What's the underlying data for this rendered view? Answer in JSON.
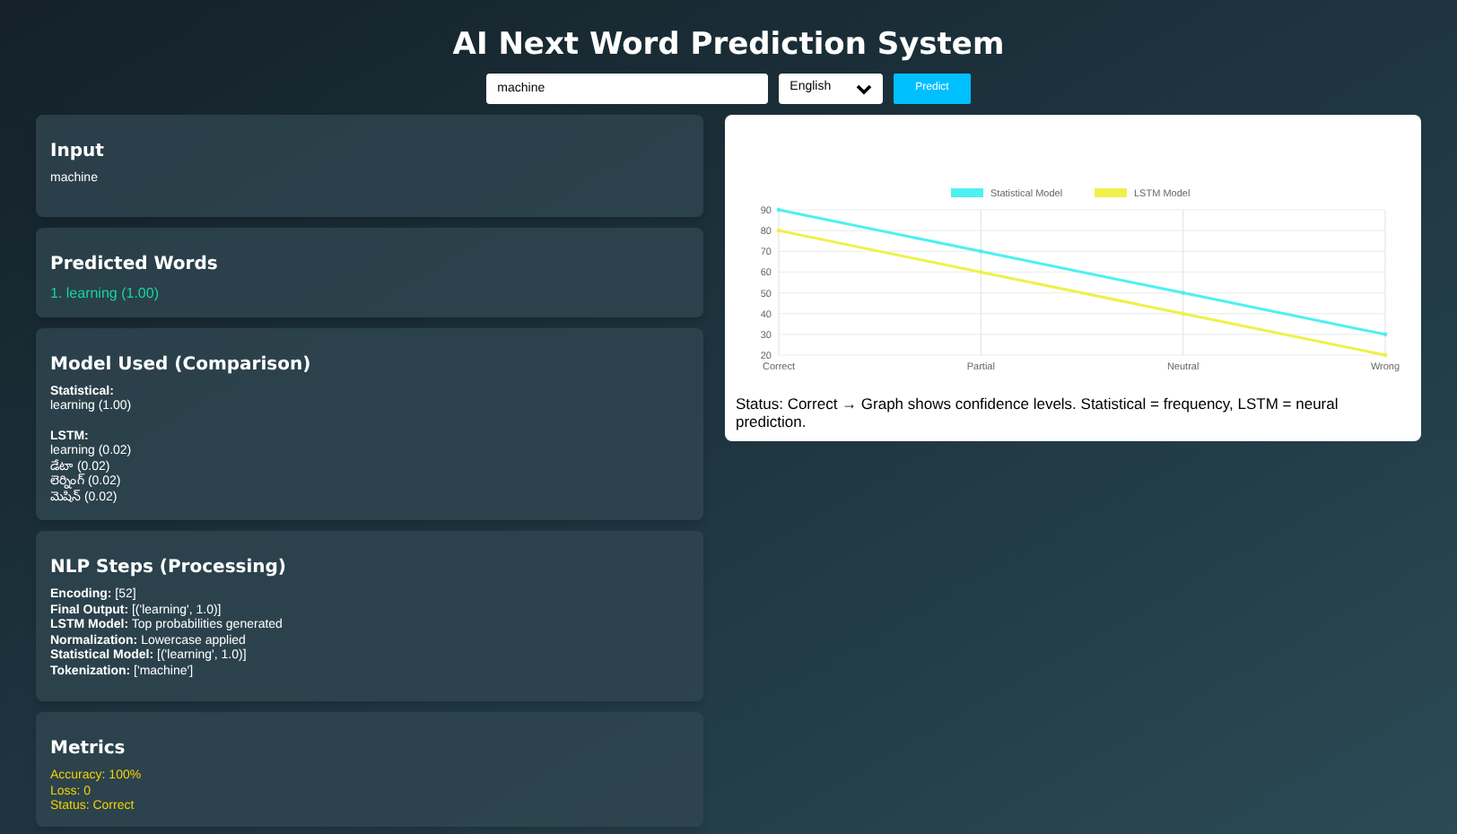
{
  "title": "AI Next Word Prediction System",
  "search": {
    "value": "machine",
    "language": "English",
    "button": "Predict"
  },
  "input_card": {
    "heading": "Input",
    "text": "machine"
  },
  "predicted_card": {
    "heading": "Predicted Words",
    "items": [
      "1. learning (1.00)"
    ]
  },
  "model_card": {
    "heading": "Model Used (Comparison)",
    "groups": [
      {
        "label": "Statistical:",
        "items": [
          "learning (1.00)"
        ]
      },
      {
        "label": "LSTM:",
        "items": [
          "learning (0.02)",
          "డేటా (0.02)",
          "లెర్నింగ్ (0.02)",
          "మెషిన్ (0.02)"
        ]
      }
    ]
  },
  "nlp_card": {
    "heading": "NLP Steps (Processing)",
    "lines": [
      "**Encoding:** [52]",
      "**Final Output:** [('learning', 1.0)]",
      "**LSTM Model:** Top probabilities generated",
      "**Normalization:** Lowercase applied",
      "**Statistical Model:** [('learning', 1.0)]",
      "**Tokenization:** ['machine']"
    ]
  },
  "metrics_card": {
    "heading": "Metrics",
    "lines": [
      "Accuracy: 100%",
      "Loss: 0",
      "Status: Correct"
    ]
  },
  "chart_card": {
    "chart_data": {
      "type": "line",
      "categories": [
        "Correct",
        "Partial",
        "Neutral",
        "Wrong"
      ],
      "series": [
        {
          "name": "Statistical Model",
          "color": "#4ef0f0",
          "values": [
            90,
            70,
            50,
            30
          ]
        },
        {
          "name": "LSTM Model",
          "color": "#f0f04a",
          "values": [
            80,
            60,
            40,
            20
          ]
        }
      ],
      "grid": true,
      "legend": true,
      "ylim": [
        20,
        90
      ],
      "yticks": [
        20,
        30,
        40,
        50,
        60,
        70,
        80,
        90
      ]
    },
    "caption": "Status: Correct → Graph shows confidence levels. Statistical = frequency, LSTM = neural prediction."
  }
}
